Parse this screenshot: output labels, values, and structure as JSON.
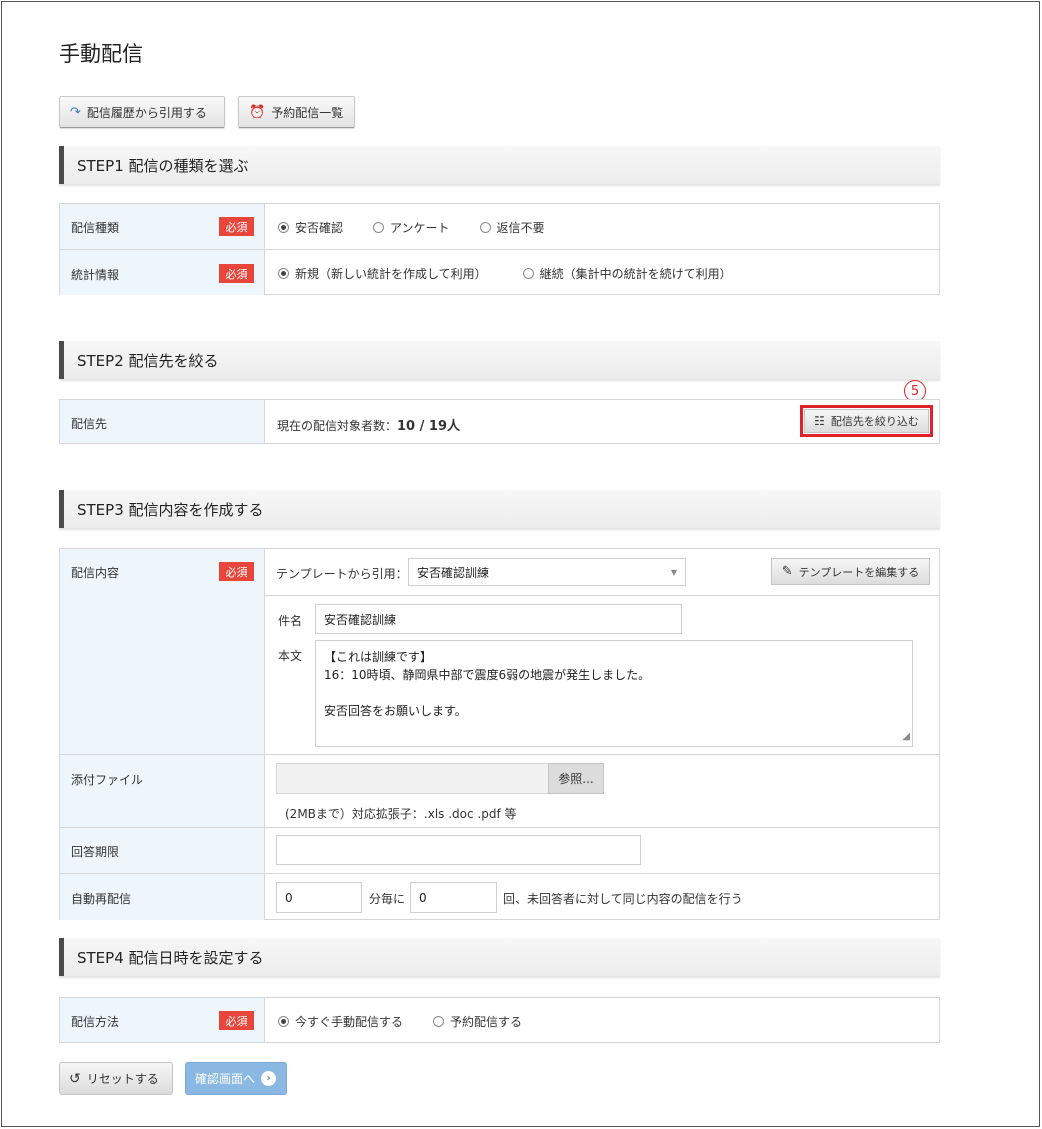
{
  "page": {
    "title": "手動配信"
  },
  "top_buttons": {
    "history": "配信履歴から引用する",
    "scheduled": "予約配信一覧"
  },
  "step1": {
    "header": "STEP1 配信の種類を選ぶ",
    "rows": [
      {
        "label": "配信種類",
        "required": "必須",
        "options": [
          "安否確認",
          "アンケート",
          "返信不要"
        ],
        "selected": 0
      },
      {
        "label": "統計情報",
        "required": "必須",
        "options": [
          "新規（新しい統計を作成して利用）",
          "継続（集計中の統計を続けて利用）"
        ],
        "selected": 0
      }
    ]
  },
  "step2": {
    "header": "STEP2 配信先を絞る",
    "label": "配信先",
    "count_prefix": "現在の配信対象者数：",
    "count_value": "10 / 19人",
    "filter_button": "配信先を絞り込む",
    "callout_number": "5",
    "highlight_color": "#e0202a"
  },
  "step3": {
    "header": "STEP3 配信内容を作成する",
    "content_label": "配信内容",
    "required": "必須",
    "template_prefix": "テンプレートから引用：",
    "template_value": "安否確認訓練",
    "edit_template_button": "テンプレートを編集する",
    "subject_label": "件名",
    "subject_value": "安否確認訓練",
    "body_label": "本文",
    "body_lines": [
      "【これは訓練です】",
      "16：10時頃、静岡県中部で震度6弱の地震が発生しました。",
      "",
      "安否回答をお願いします。"
    ],
    "attach_label": "添付ファイル",
    "browse_button": "参照...",
    "attach_note": "(2MBまで）対応拡張子：.xls .doc .pdf 等",
    "deadline_label": "回答期限",
    "deadline_value": "",
    "resend_label": "自動再配信",
    "resend_minutes": "0",
    "resend_mid": "分毎に",
    "resend_times": "0",
    "resend_suffix": "回、未回答者に対して同じ内容の配信を行う"
  },
  "step4": {
    "header": "STEP4 配信日時を設定する",
    "label": "配信方法",
    "required": "必須",
    "options": [
      "今すぐ手動配信する",
      "予約配信する"
    ],
    "selected": 0
  },
  "footer": {
    "reset": "リセットする",
    "confirm": "確認画面へ"
  },
  "colors": {
    "required_bg": "#e8463c",
    "label_bg": "#eef6fc",
    "confirm_bg": "#8ab8e2"
  }
}
